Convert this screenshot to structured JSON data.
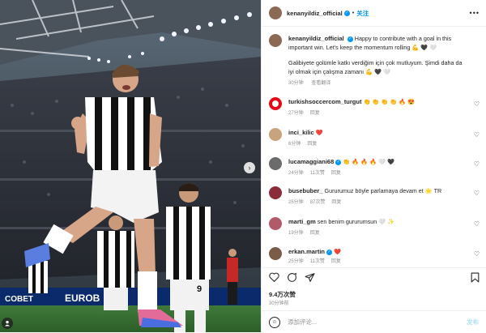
{
  "post": {
    "author": "kenanyildiz_official",
    "follow_label": "关注",
    "caption_en": "Happy to contribute with a goal in this important win. Let's keep the momentum rolling 💪 🖤 🤍",
    "caption_tr": "Galibiyete golümle katkı verdiğim için çok mutluyum. Şimdi daha da iyi olmak için çalışma zamanı 💪 🖤 🤍",
    "caption_time": "30分钟",
    "see_translation": "查看翻译",
    "likes": "9.4万次赞",
    "time_ago": "30分钟前",
    "comment_placeholder": "添加评论...",
    "post_label": "发布",
    "image_banner_1": "COBET",
    "image_banner_2": "EUROB",
    "jersey_number": "9"
  },
  "comments": [
    {
      "user": "turkishsoccercom_turgut",
      "text": "👏 👏 👏 👏 🔥 😍",
      "time": "27分钟",
      "likes": "",
      "reply": "回复",
      "avatar_color": "#e30a17",
      "verified": false
    },
    {
      "user": "inci_kilic",
      "text": "❤️",
      "time": "6分钟",
      "likes": "",
      "reply": "回复",
      "avatar_color": "#c9a27e",
      "verified": false
    },
    {
      "user": "lucamaggiani68",
      "text": "👏 🔥 🔥 🔥 🤍 🖤",
      "time": "24分钟",
      "likes": "11次赞",
      "reply": "回复",
      "avatar_color": "#6b6b6b",
      "verified": true
    },
    {
      "user": "busebuber_",
      "text": "Gururumuz böyle parlamaya devam et 🌟 TR",
      "time": "25分钟",
      "likes": "87次赞",
      "reply": "回复",
      "avatar_color": "#8a2d3b",
      "verified": false
    },
    {
      "user": "marti_gm",
      "text": "sen benim gururumsun 🤍 ✨",
      "time": "19分钟",
      "likes": "",
      "reply": "回复",
      "avatar_color": "#b05a6a",
      "verified": false
    },
    {
      "user": "erkan.martin",
      "text": "❤️",
      "time": "25分钟",
      "likes": "11次赞",
      "reply": "回复",
      "avatar_color": "#7a5c48",
      "verified": true
    }
  ],
  "icons": {
    "like": "heart-icon",
    "comment": "comment-icon",
    "share": "share-icon",
    "save": "bookmark-icon",
    "more": "more-icon",
    "emoji": "emoji-icon",
    "next": "chevron-right-icon",
    "tagged_user": "user-icon"
  },
  "colors": {
    "accent": "#0095f6",
    "verified": "#0095f6",
    "muted": "#8e8e8e",
    "text": "#262626"
  }
}
